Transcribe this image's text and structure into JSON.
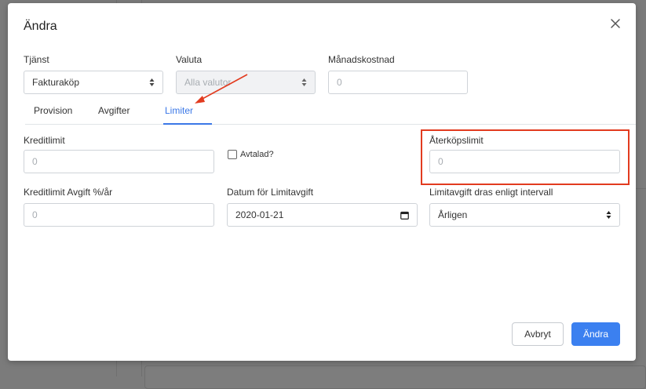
{
  "modal": {
    "title": "Ändra"
  },
  "top_fields": {
    "service_label": "Tjänst",
    "service_value": "Fakturaköp",
    "currency_label": "Valuta",
    "currency_placeholder": "Alla valutor",
    "monthly_cost_label": "Månadskostnad",
    "monthly_cost_placeholder": "0"
  },
  "tabs": [
    {
      "label": "Provision",
      "active": false
    },
    {
      "label": "Avgifter",
      "active": false
    },
    {
      "label": "Limiter",
      "active": true
    }
  ],
  "limits": {
    "credit_limit_label": "Kreditlimit",
    "credit_limit_placeholder": "0",
    "agreed_label": "Avtalad?",
    "agreed_checked": false,
    "buyback_limit_label": "Återköpslimit",
    "buyback_limit_placeholder": "0",
    "credit_fee_label": "Kreditlimit Avgift %/år",
    "credit_fee_placeholder": "0",
    "fee_date_label": "Datum för Limitavgift",
    "fee_date_value": "2020-01-21",
    "interval_label": "Limitavgift dras enligt intervall",
    "interval_value": "Årligen"
  },
  "footer": {
    "cancel_label": "Avbryt",
    "submit_label": "Ändra"
  },
  "colors": {
    "accent": "#3b78e7",
    "primary_button": "#3b80f0",
    "annotation": "#e23b1f"
  },
  "icons": {
    "close": "close-icon",
    "select": "select-updown-icon",
    "calendar": "calendar-icon"
  }
}
